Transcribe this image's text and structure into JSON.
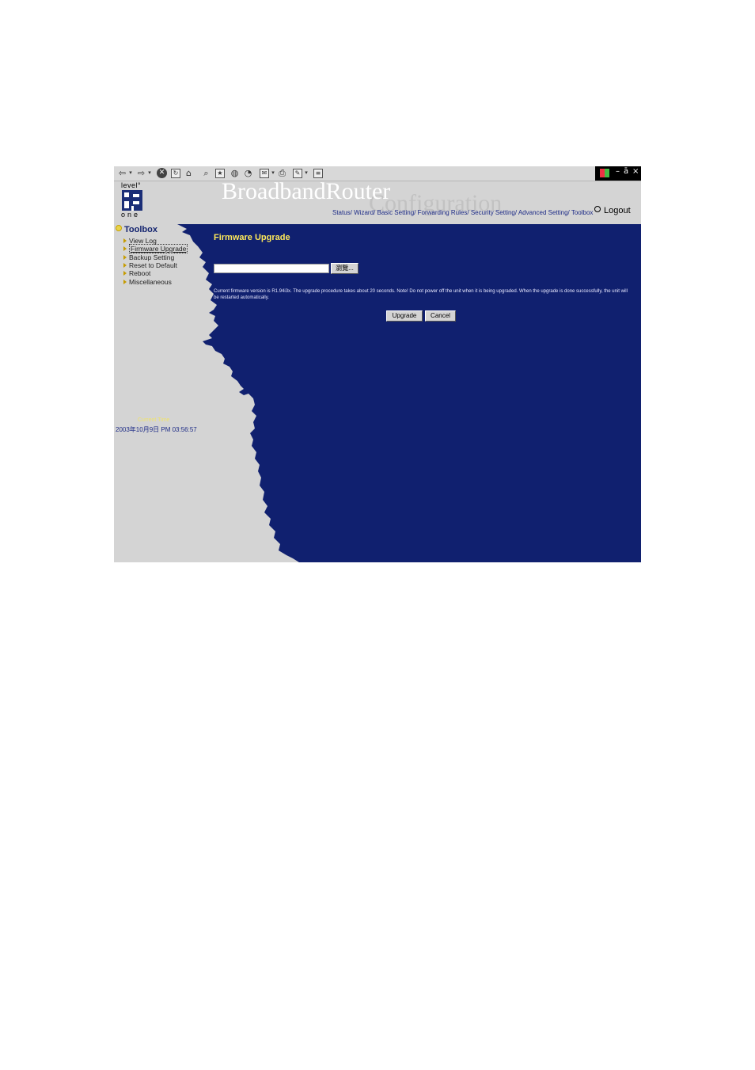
{
  "browser": {
    "window_controls": {
      "minimize": "–",
      "restore": "ā",
      "close": "×"
    }
  },
  "header": {
    "logo_top": "level°",
    "logo_bottom": "one",
    "title_main": "BroadbandRouter",
    "title_sub": "Configuration",
    "nav": [
      "Status/",
      "Wizard/",
      "Basic Setting/",
      "Forwarding Rules/",
      "Security Setting/",
      "Advanced Setting/",
      "Toolbox"
    ],
    "logout_label": "Logout"
  },
  "sidebar": {
    "title": "Toolbox",
    "items": [
      {
        "label": "View Log"
      },
      {
        "label": "Firmware Upgrade"
      },
      {
        "label": "Backup Setting"
      },
      {
        "label": "Reset to Default"
      },
      {
        "label": "Reboot"
      },
      {
        "label": "Miscellaneous"
      }
    ],
    "current_time_label": "Current Time",
    "current_time_value": "2003年10月9日 PM 03:56:57"
  },
  "main": {
    "title": "Firmware Upgrade",
    "file_input_value": "",
    "browse_label": "瀏覽...",
    "note": "Current firmware version is R1.94i3x. The upgrade procedure takes about 20 seconds. Note! Do not power off the unit when it is being upgraded. When the upgrade is done successfully, the unit will be restarted automatically.",
    "upgrade_label": "Upgrade",
    "cancel_label": "Cancel"
  },
  "colors": {
    "panel_blue": "#10206f",
    "sidebar_gray": "#d4d4d4",
    "title_yellow": "#ffe95a",
    "nav_blue": "#1c2a86"
  }
}
